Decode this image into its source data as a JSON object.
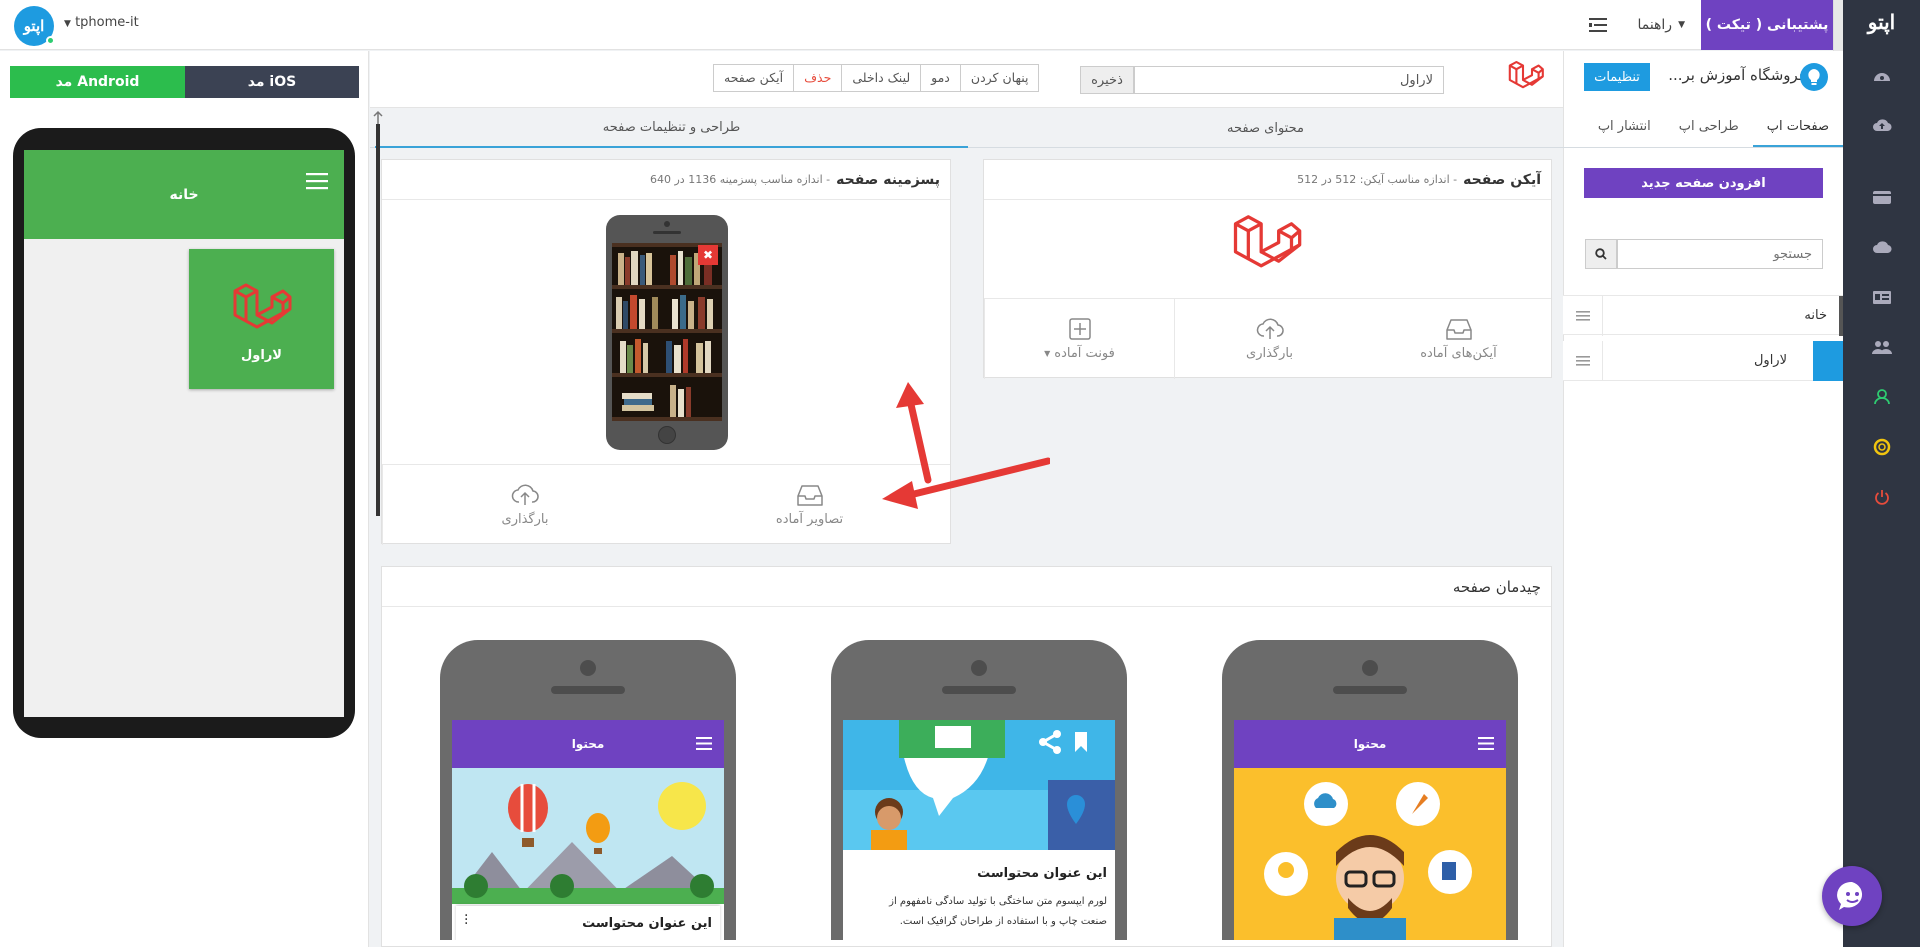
{
  "topbar": {
    "support_label": "پشتیبانی ( تیکت )",
    "guide_label": "راهنما",
    "account_name": "tphome-it",
    "brand_text": "اپتو"
  },
  "rail": {
    "logo": "اپتو"
  },
  "preview": {
    "android_label": "مد Android",
    "ios_label": "مد iOS",
    "screen_title": "خانه",
    "tile_label": "لاراول"
  },
  "toolbar": {
    "title_value": "لاراول",
    "save_label": "ذخیره",
    "segments": [
      "پنهان کردن",
      "دمو",
      "لینک داخلی",
      "حذف",
      "آیکن صفحه"
    ]
  },
  "tabs": {
    "content": "محتوای صفحه",
    "design": "طراحی و تنظیمات صفحه"
  },
  "icon_card": {
    "title": "آیکن صفحه",
    "hint": "- اندازه مناسب آیکن: 512 در 512",
    "opt_ready": "آیکن‌های آماده",
    "opt_upload": "بارگذاری",
    "opt_font": "فونت آماده"
  },
  "bg_card": {
    "title": "پسزمینه صفحه",
    "hint": "- اندازه مناسب پسزمینه 1136 در 640",
    "opt_ready": "تصاویر آماده",
    "opt_upload": "بارگذاری"
  },
  "layout": {
    "title": "چیدمان صفحه",
    "phone_header": "محتوا",
    "content_title": "این عنوان محتواست",
    "content_text_1": "لورم ایپسوم متن ساختگی با تولید سادگی نامفهوم از",
    "content_text_2": "صنعت چاپ و با استفاده از طراحان گرافیک است."
  },
  "sidebar": {
    "settings_label": "تنظیمات",
    "store_name": "فروشگاه آموزش بر...",
    "tabs": [
      "صفحات اپ",
      "طراحی اپ",
      "انتشار اپ"
    ],
    "add_page_label": "افزودن صفحه جدید",
    "search_placeholder": "جستجو",
    "pages": [
      "خانه",
      "لاراول"
    ]
  }
}
